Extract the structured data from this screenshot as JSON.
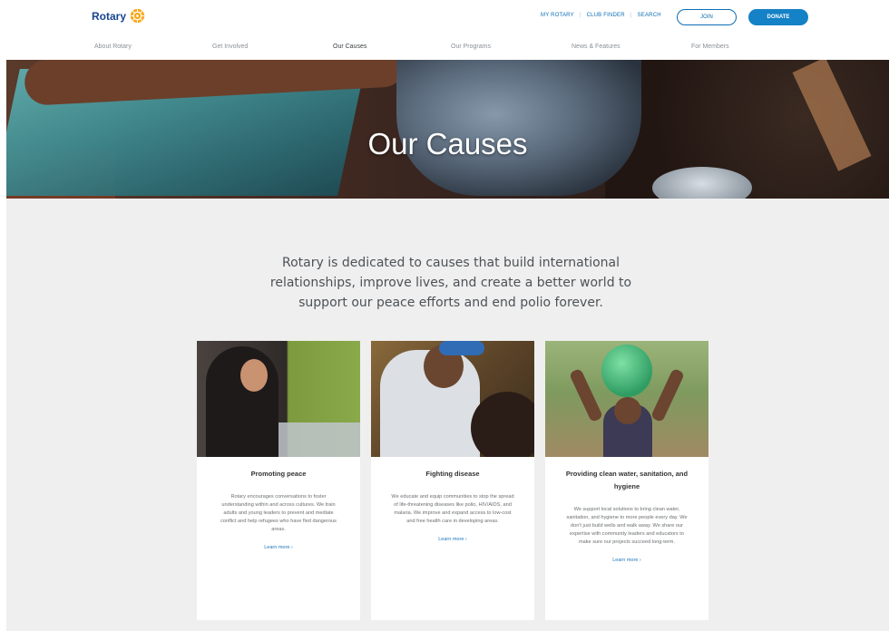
{
  "header": {
    "logo_text": "Rotary",
    "utility_links": [
      "MY ROTARY",
      "CLUB FINDER",
      "SEARCH"
    ],
    "join_label": "JOIN",
    "donate_label": "DONATE",
    "accent_color": "#0c6eb5",
    "brand_gold": "#f7a81b"
  },
  "nav": {
    "items": [
      "About Rotary",
      "Get Involved",
      "Our Causes",
      "Our Programs",
      "News & Features",
      "For Members"
    ],
    "active": "Our Causes"
  },
  "hero": {
    "title": "Our Causes"
  },
  "intro": {
    "text": "Rotary is dedicated to causes that build international relationships, improve lives, and create a better world to support our peace efforts and end polio forever."
  },
  "cards": [
    {
      "title": "Promoting peace",
      "text": "Rotary encourages conversations to foster understanding within and across cultures. We train adults and young leaders to prevent and mediate conflict and help refugees who have fled dangerous areas.",
      "link": "Learn more ›"
    },
    {
      "title": "Fighting disease",
      "text": "We educate and equip communities to stop the spread of life-threatening diseases like polio, HIV/AIDS, and malaria. We improve and expand access to low-cost and free health care in developing areas.",
      "link": "Learn more ›"
    },
    {
      "title": "Providing clean water, sanitation, and hygiene",
      "text": "We support local solutions to bring clean water, sanitation, and hygiene to more people every day. We don't just build wells and walk away. We share our expertise with community leaders and educators to make sure our projects succeed long-term.",
      "link": "Learn more ›"
    }
  ]
}
